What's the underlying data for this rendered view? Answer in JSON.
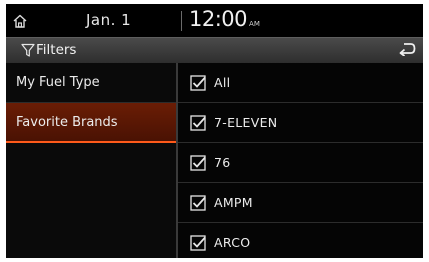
{
  "status_bar": {
    "date": "Jan.  1",
    "time": "12:00",
    "ampm": "AM",
    "home_icon": "home-icon"
  },
  "title_bar": {
    "title": "Filters",
    "filter_icon": "funnel-icon",
    "back_icon": "return-arrow-icon"
  },
  "left_menu": {
    "items": [
      {
        "label": "My Fuel Type",
        "selected": false
      },
      {
        "label": "Favorite Brands",
        "selected": true
      }
    ]
  },
  "brands": {
    "items": [
      {
        "label": "All",
        "checked": true
      },
      {
        "label": "7-ELEVEN",
        "checked": true
      },
      {
        "label": "76",
        "checked": true
      },
      {
        "label": "AMPM",
        "checked": true
      },
      {
        "label": "ARCO",
        "checked": true
      }
    ]
  },
  "colors": {
    "background": "#050505",
    "accent": "#ff5a1a",
    "selected_bg": "#5a1704",
    "title_bar": "#3c3c3c"
  }
}
